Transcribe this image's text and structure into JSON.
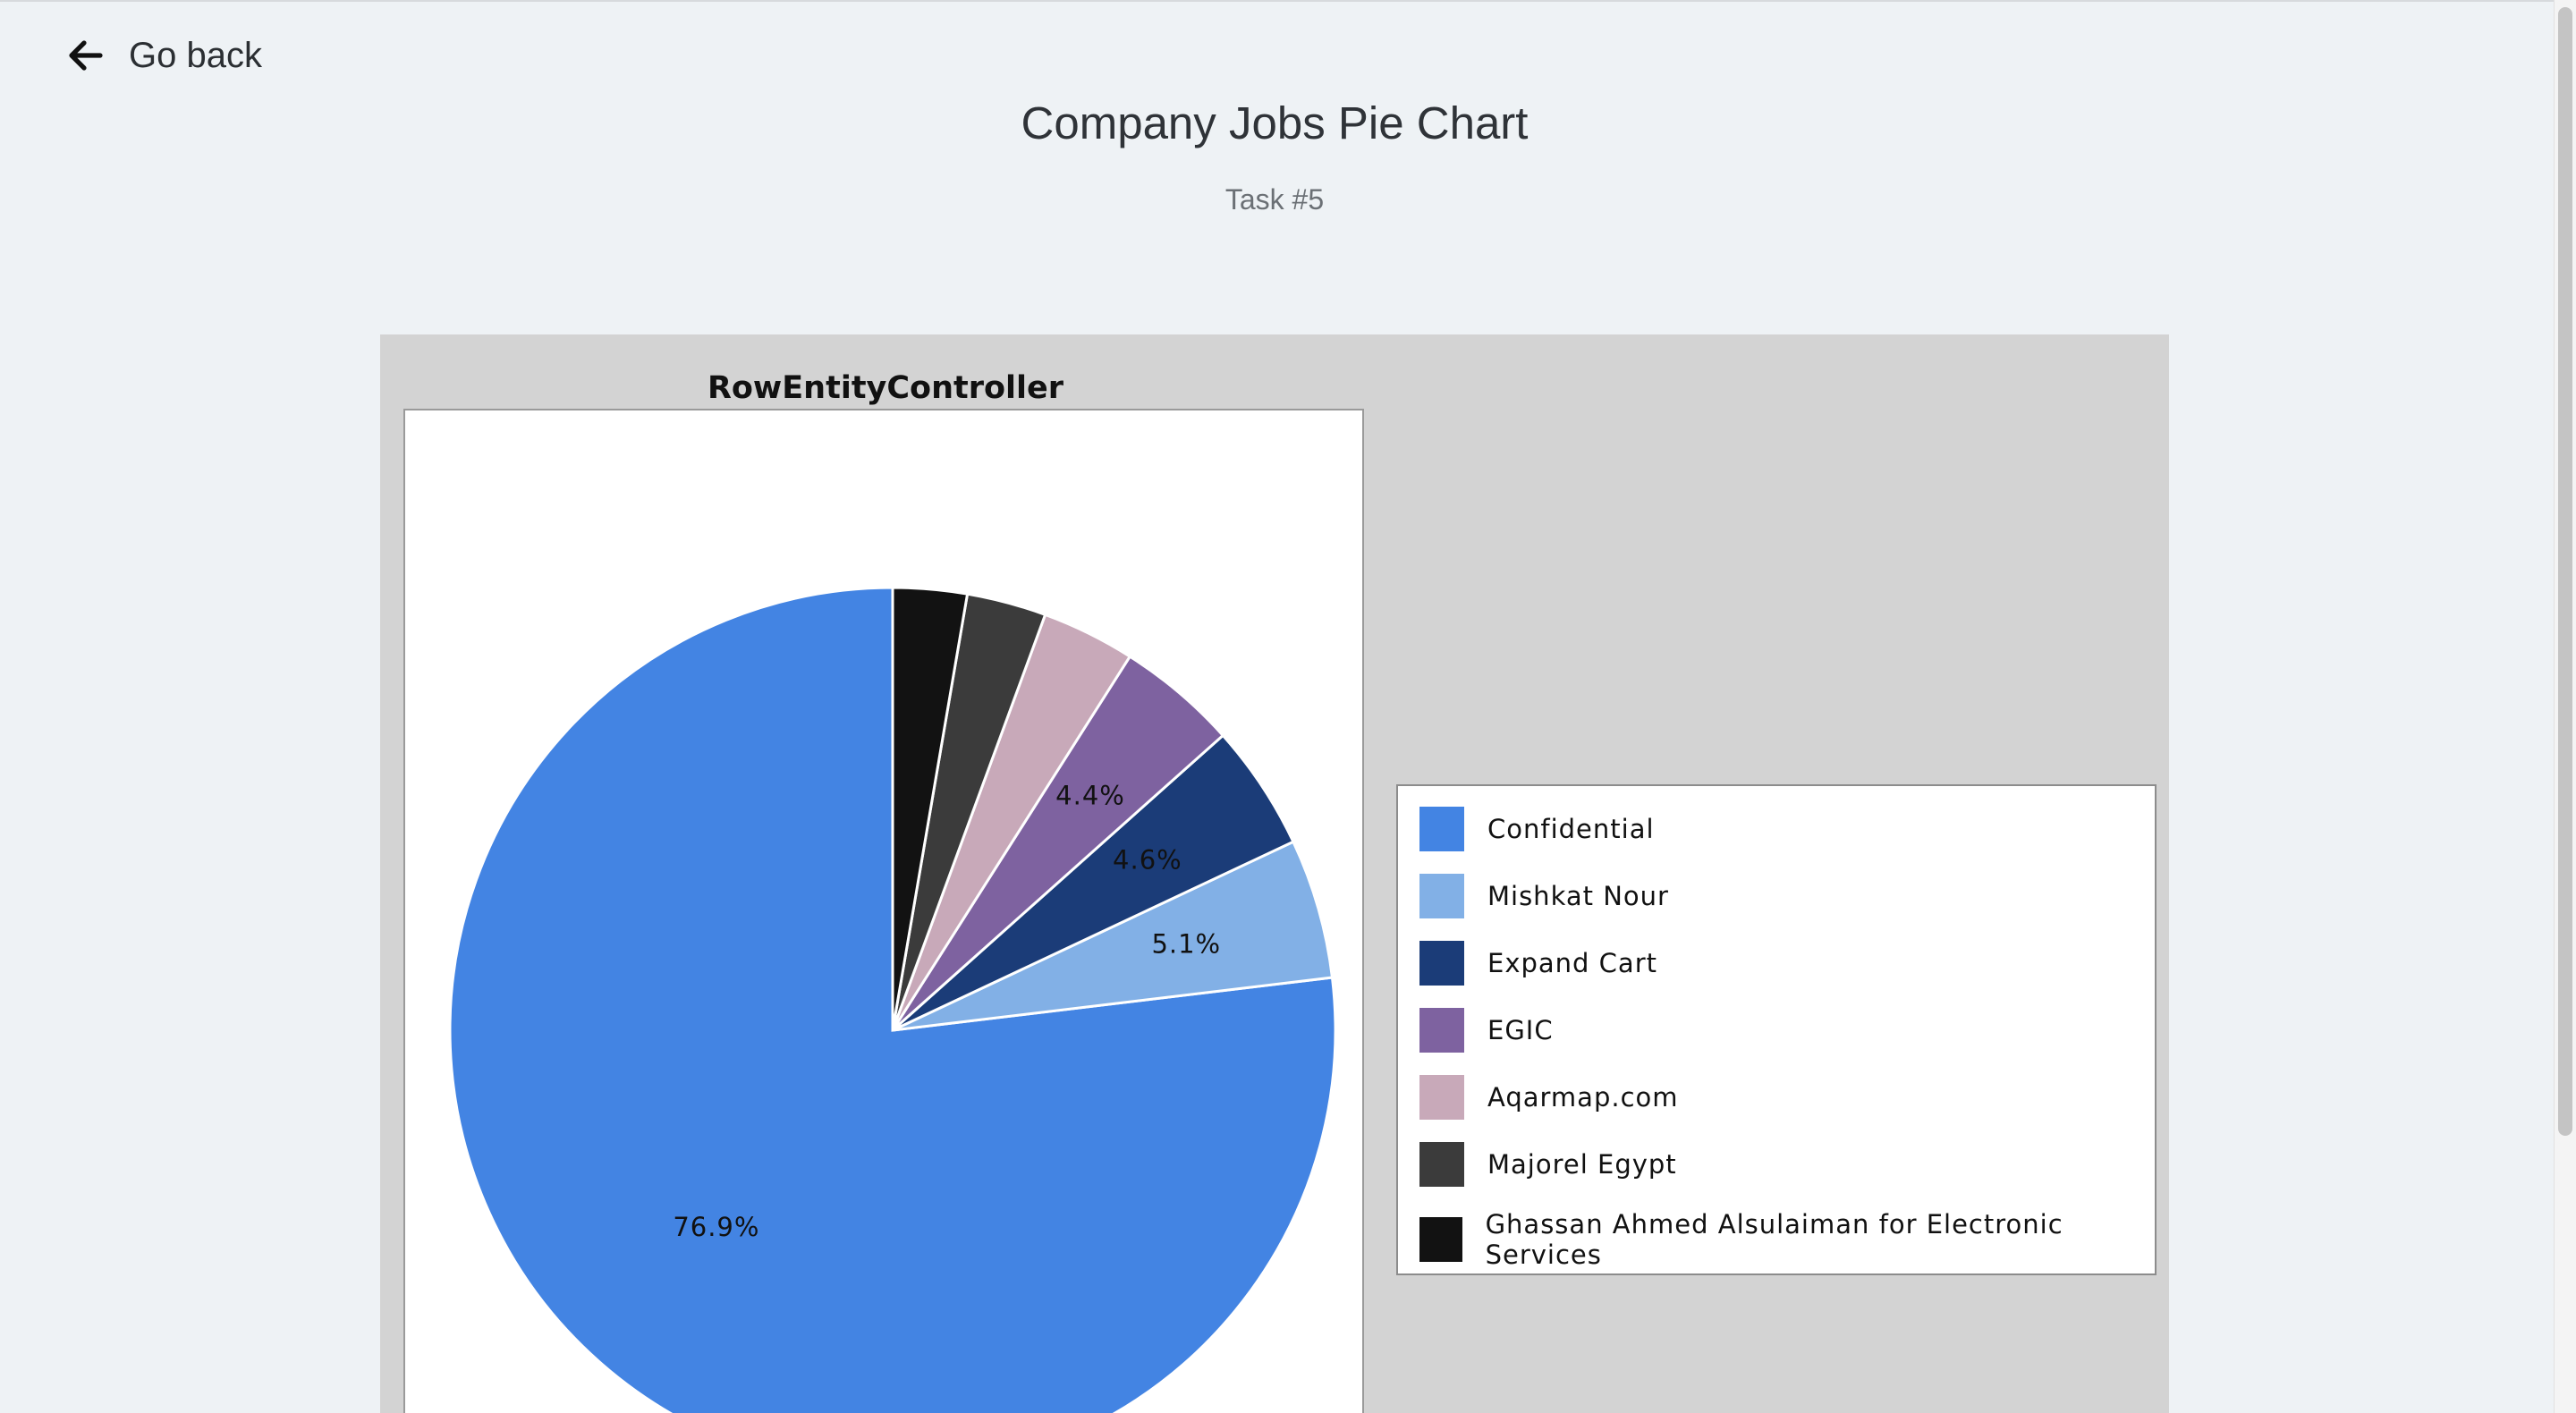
{
  "nav": {
    "back_label": "Go back"
  },
  "header": {
    "title": "Company Jobs Pie Chart",
    "subtitle": "Task #5"
  },
  "chart_data": {
    "type": "pie",
    "title": "RowEntityController",
    "legend_placement": "right",
    "slices": [
      {
        "label": "Confidential",
        "value": 76.9,
        "color": "#4384e3",
        "shown_label": "76.9%"
      },
      {
        "label": "Mishkat Nour",
        "value": 5.1,
        "color": "#82b0e6",
        "shown_label": "5.1%"
      },
      {
        "label": "Expand Cart",
        "value": 4.6,
        "color": "#1b3c78",
        "shown_label": "4.6%"
      },
      {
        "label": "EGIC",
        "value": 4.4,
        "color": "#7e62a0",
        "shown_label": "4.4%"
      },
      {
        "label": "Aqarmap.com",
        "value": 3.4,
        "color": "#c8a9b9",
        "shown_label": ""
      },
      {
        "label": "Majorel Egypt",
        "value": 2.9,
        "color": "#3b3b3b",
        "shown_label": ""
      },
      {
        "label": "Ghassan Ahmed Alsulaiman for Electronic Services",
        "value": 2.7,
        "color": "#121212",
        "shown_label": ""
      }
    ]
  }
}
